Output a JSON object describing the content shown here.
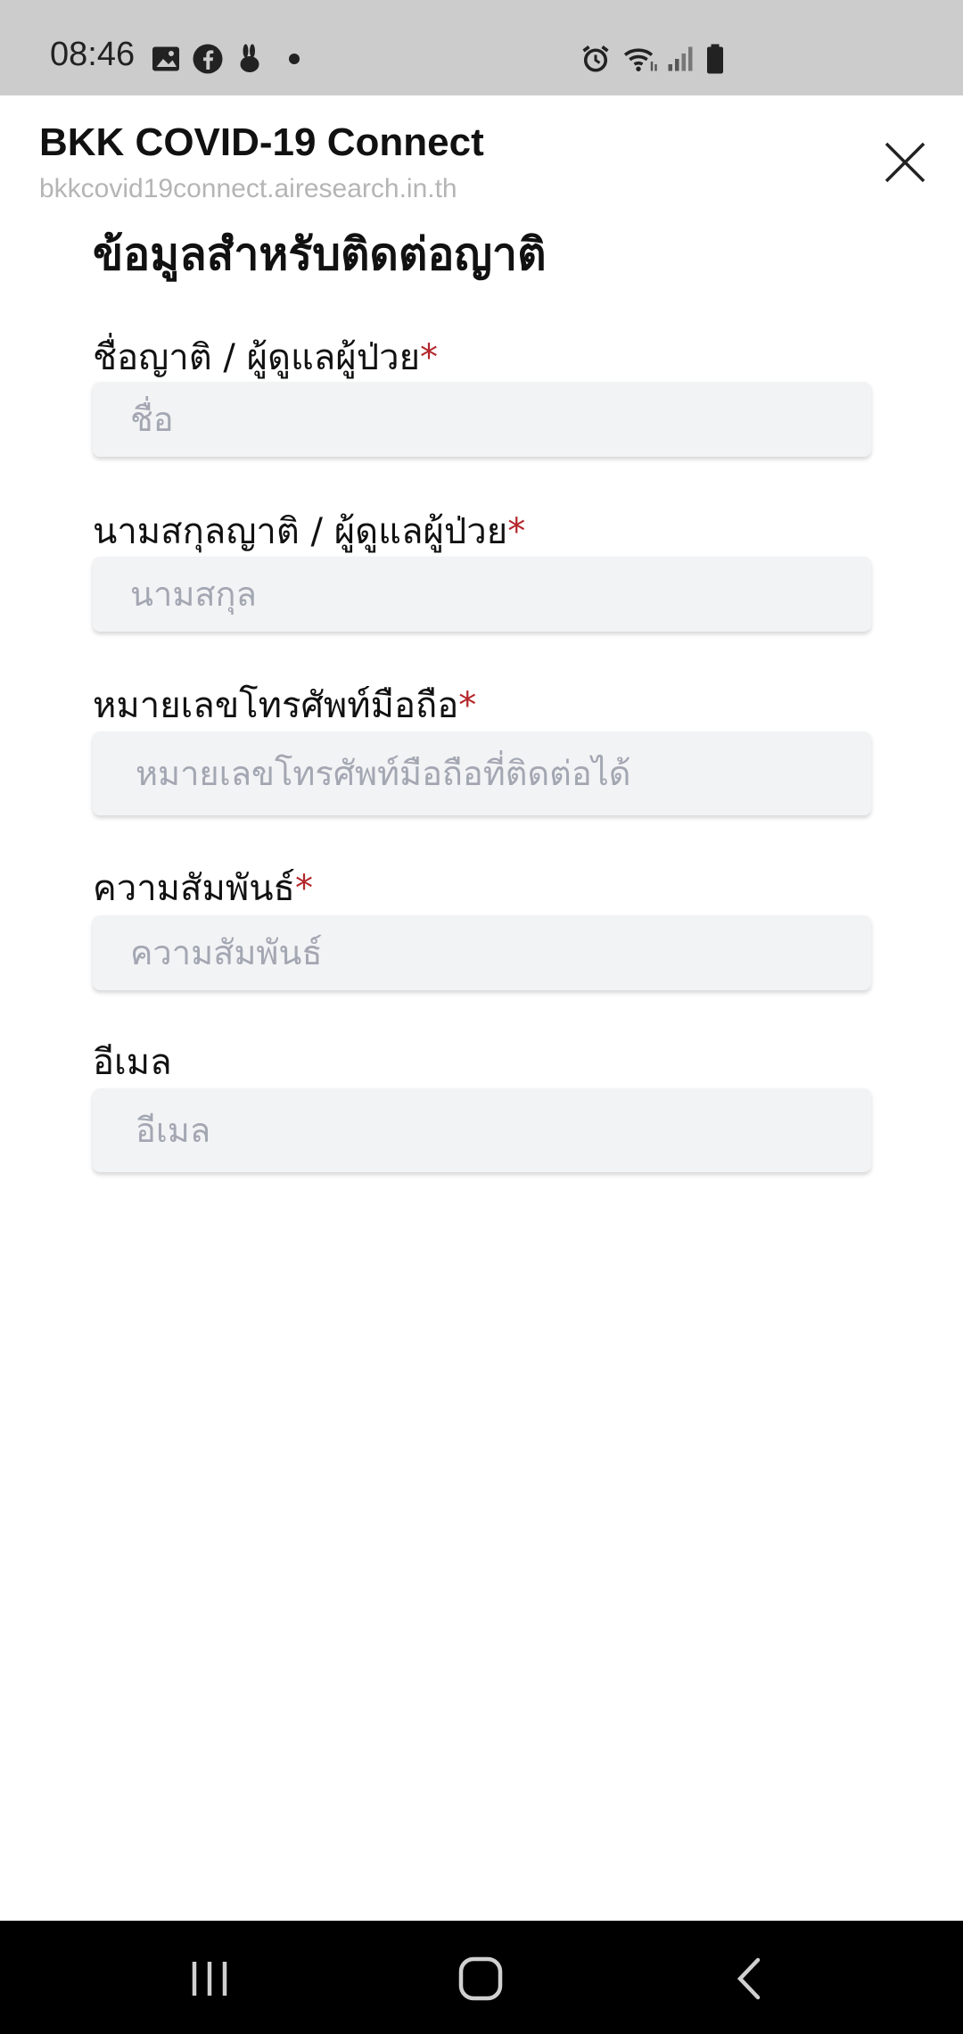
{
  "status_bar": {
    "time": "08:46",
    "icons_left": [
      "image-icon",
      "facebook-icon",
      "rabbit-icon",
      "dot-icon"
    ],
    "icons_right": [
      "alarm-icon",
      "wifi-icon",
      "signal-icon",
      "battery-icon"
    ]
  },
  "header": {
    "title": "BKK COVID-19 Connect",
    "url": "bkkcovid19connect.airesearch.in.th",
    "close_icon": "close-icon"
  },
  "form": {
    "title": "ข้อมูลสำหรับติดต่อญาติ",
    "required_marker": "*",
    "fields": [
      {
        "label": "ชื่อญาติ / ผู้ดูแลผู้ป่วย",
        "required": true,
        "placeholder": "ชื่อ",
        "value": ""
      },
      {
        "label": "นามสกุลญาติ / ผู้ดูแลผู้ป่วย",
        "required": true,
        "placeholder": "นามสกุล",
        "value": ""
      },
      {
        "label": "หมายเลขโทรศัพท์มือถือ",
        "required": true,
        "placeholder": "หมายเลขโทรศัพท์มือถือที่ติดต่อได้",
        "value": ""
      },
      {
        "label": "ความสัมพันธ์",
        "required": true,
        "placeholder": "ความสัมพันธ์",
        "value": ""
      },
      {
        "label": "อีเมล",
        "required": false,
        "placeholder": "อีเมล",
        "value": ""
      }
    ]
  },
  "nav_bar": {
    "buttons": [
      "recent-apps-icon",
      "home-icon",
      "back-icon"
    ]
  },
  "colors": {
    "status_bar_bg": "#cccccc",
    "required": "#b3262a",
    "input_bg": "#f2f3f5",
    "nav_bg": "#000000"
  }
}
